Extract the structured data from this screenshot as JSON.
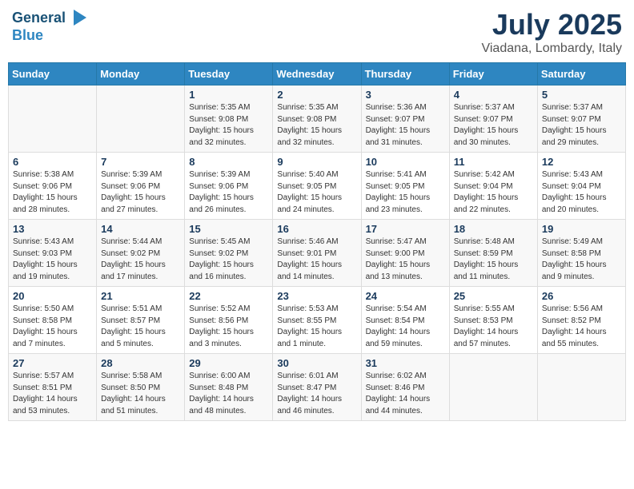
{
  "logo": {
    "line1": "General",
    "line2": "Blue",
    "icon": "▶"
  },
  "title": "July 2025",
  "subtitle": "Viadana, Lombardy, Italy",
  "headers": [
    "Sunday",
    "Monday",
    "Tuesday",
    "Wednesday",
    "Thursday",
    "Friday",
    "Saturday"
  ],
  "weeks": [
    [
      {
        "day": "",
        "info": ""
      },
      {
        "day": "",
        "info": ""
      },
      {
        "day": "1",
        "info": "Sunrise: 5:35 AM\nSunset: 9:08 PM\nDaylight: 15 hours\nand 32 minutes."
      },
      {
        "day": "2",
        "info": "Sunrise: 5:35 AM\nSunset: 9:08 PM\nDaylight: 15 hours\nand 32 minutes."
      },
      {
        "day": "3",
        "info": "Sunrise: 5:36 AM\nSunset: 9:07 PM\nDaylight: 15 hours\nand 31 minutes."
      },
      {
        "day": "4",
        "info": "Sunrise: 5:37 AM\nSunset: 9:07 PM\nDaylight: 15 hours\nand 30 minutes."
      },
      {
        "day": "5",
        "info": "Sunrise: 5:37 AM\nSunset: 9:07 PM\nDaylight: 15 hours\nand 29 minutes."
      }
    ],
    [
      {
        "day": "6",
        "info": "Sunrise: 5:38 AM\nSunset: 9:06 PM\nDaylight: 15 hours\nand 28 minutes."
      },
      {
        "day": "7",
        "info": "Sunrise: 5:39 AM\nSunset: 9:06 PM\nDaylight: 15 hours\nand 27 minutes."
      },
      {
        "day": "8",
        "info": "Sunrise: 5:39 AM\nSunset: 9:06 PM\nDaylight: 15 hours\nand 26 minutes."
      },
      {
        "day": "9",
        "info": "Sunrise: 5:40 AM\nSunset: 9:05 PM\nDaylight: 15 hours\nand 24 minutes."
      },
      {
        "day": "10",
        "info": "Sunrise: 5:41 AM\nSunset: 9:05 PM\nDaylight: 15 hours\nand 23 minutes."
      },
      {
        "day": "11",
        "info": "Sunrise: 5:42 AM\nSunset: 9:04 PM\nDaylight: 15 hours\nand 22 minutes."
      },
      {
        "day": "12",
        "info": "Sunrise: 5:43 AM\nSunset: 9:04 PM\nDaylight: 15 hours\nand 20 minutes."
      }
    ],
    [
      {
        "day": "13",
        "info": "Sunrise: 5:43 AM\nSunset: 9:03 PM\nDaylight: 15 hours\nand 19 minutes."
      },
      {
        "day": "14",
        "info": "Sunrise: 5:44 AM\nSunset: 9:02 PM\nDaylight: 15 hours\nand 17 minutes."
      },
      {
        "day": "15",
        "info": "Sunrise: 5:45 AM\nSunset: 9:02 PM\nDaylight: 15 hours\nand 16 minutes."
      },
      {
        "day": "16",
        "info": "Sunrise: 5:46 AM\nSunset: 9:01 PM\nDaylight: 15 hours\nand 14 minutes."
      },
      {
        "day": "17",
        "info": "Sunrise: 5:47 AM\nSunset: 9:00 PM\nDaylight: 15 hours\nand 13 minutes."
      },
      {
        "day": "18",
        "info": "Sunrise: 5:48 AM\nSunset: 8:59 PM\nDaylight: 15 hours\nand 11 minutes."
      },
      {
        "day": "19",
        "info": "Sunrise: 5:49 AM\nSunset: 8:58 PM\nDaylight: 15 hours\nand 9 minutes."
      }
    ],
    [
      {
        "day": "20",
        "info": "Sunrise: 5:50 AM\nSunset: 8:58 PM\nDaylight: 15 hours\nand 7 minutes."
      },
      {
        "day": "21",
        "info": "Sunrise: 5:51 AM\nSunset: 8:57 PM\nDaylight: 15 hours\nand 5 minutes."
      },
      {
        "day": "22",
        "info": "Sunrise: 5:52 AM\nSunset: 8:56 PM\nDaylight: 15 hours\nand 3 minutes."
      },
      {
        "day": "23",
        "info": "Sunrise: 5:53 AM\nSunset: 8:55 PM\nDaylight: 15 hours\nand 1 minute."
      },
      {
        "day": "24",
        "info": "Sunrise: 5:54 AM\nSunset: 8:54 PM\nDaylight: 14 hours\nand 59 minutes."
      },
      {
        "day": "25",
        "info": "Sunrise: 5:55 AM\nSunset: 8:53 PM\nDaylight: 14 hours\nand 57 minutes."
      },
      {
        "day": "26",
        "info": "Sunrise: 5:56 AM\nSunset: 8:52 PM\nDaylight: 14 hours\nand 55 minutes."
      }
    ],
    [
      {
        "day": "27",
        "info": "Sunrise: 5:57 AM\nSunset: 8:51 PM\nDaylight: 14 hours\nand 53 minutes."
      },
      {
        "day": "28",
        "info": "Sunrise: 5:58 AM\nSunset: 8:50 PM\nDaylight: 14 hours\nand 51 minutes."
      },
      {
        "day": "29",
        "info": "Sunrise: 6:00 AM\nSunset: 8:48 PM\nDaylight: 14 hours\nand 48 minutes."
      },
      {
        "day": "30",
        "info": "Sunrise: 6:01 AM\nSunset: 8:47 PM\nDaylight: 14 hours\nand 46 minutes."
      },
      {
        "day": "31",
        "info": "Sunrise: 6:02 AM\nSunset: 8:46 PM\nDaylight: 14 hours\nand 44 minutes."
      },
      {
        "day": "",
        "info": ""
      },
      {
        "day": "",
        "info": ""
      }
    ]
  ]
}
